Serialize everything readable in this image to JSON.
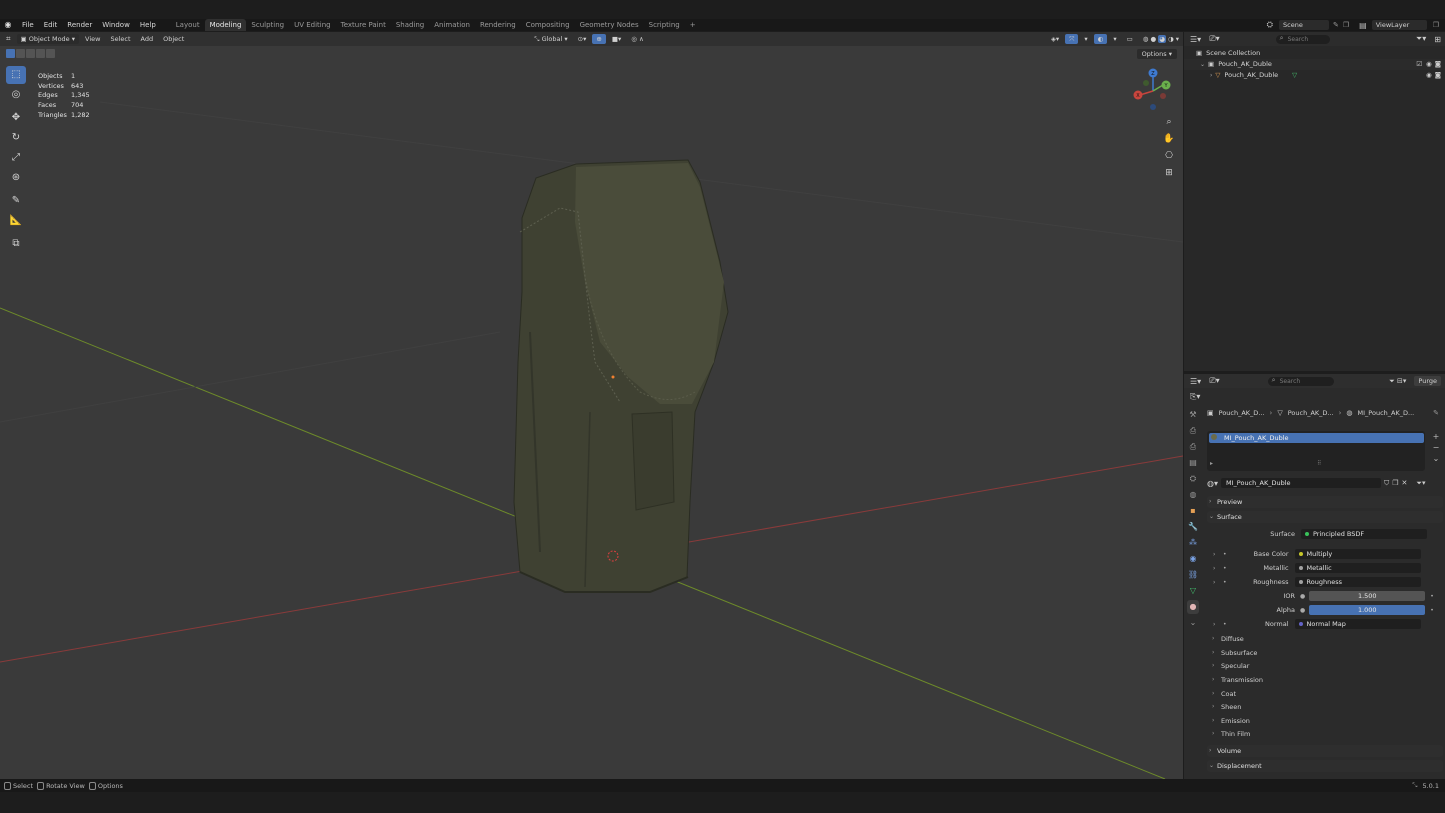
{
  "menu": [
    "File",
    "Edit",
    "Render",
    "Window",
    "Help"
  ],
  "workspaces": [
    {
      "label": "Layout",
      "active": false
    },
    {
      "label": "Modeling",
      "active": true
    },
    {
      "label": "Sculpting",
      "active": false
    },
    {
      "label": "UV Editing",
      "active": false
    },
    {
      "label": "Texture Paint",
      "active": false
    },
    {
      "label": "Shading",
      "active": false
    },
    {
      "label": "Animation",
      "active": false
    },
    {
      "label": "Rendering",
      "active": false
    },
    {
      "label": "Compositing",
      "active": false
    },
    {
      "label": "Geometry Nodes",
      "active": false
    },
    {
      "label": "Scripting",
      "active": false
    }
  ],
  "add_workspace": "+",
  "scene": {
    "label": "Scene",
    "view_layer": "ViewLayer"
  },
  "viewport": {
    "mode": "Object Mode",
    "menus": [
      "View",
      "Select",
      "Add",
      "Object"
    ],
    "orientation": "Global",
    "options_label": "Options",
    "stats": [
      {
        "label": "Objects",
        "value": "1"
      },
      {
        "label": "Vertices",
        "value": "643"
      },
      {
        "label": "Edges",
        "value": "1,345"
      },
      {
        "label": "Faces",
        "value": "704"
      },
      {
        "label": "Triangles",
        "value": "1,282"
      }
    ],
    "gizmo": {
      "z": "Z",
      "y": "Y",
      "x": "X"
    }
  },
  "outliner": {
    "search_placeholder": "Search",
    "items": [
      {
        "label": "Scene Collection"
      },
      {
        "label": "Pouch_AK_Duble"
      },
      {
        "label": "Pouch_AK_Duble"
      }
    ]
  },
  "properties": {
    "search_placeholder": "Search",
    "purge_label": "Purge",
    "breadcrumb": [
      "Pouch_AK_D...",
      "Pouch_AK_D...",
      "MI_Pouch_AK_D..."
    ],
    "material_slot": "MI_Pouch_AK_Duble",
    "material_name": "MI_Pouch_AK_Duble",
    "panels": {
      "preview": "Preview",
      "surface": "Surface",
      "volume": "Volume",
      "displacement": "Displacement"
    },
    "surface_rows": [
      {
        "label": "Surface",
        "value": "Principled BSDF",
        "dot": "#39c25a",
        "kind": "link"
      },
      {
        "label": "Base Color",
        "value": "Multiply",
        "dot": "#c7c729",
        "kind": "link"
      },
      {
        "label": "Metallic",
        "value": "Metallic",
        "dot": "#a1a1a1",
        "kind": "link"
      },
      {
        "label": "Roughness",
        "value": "Roughness",
        "dot": "#a1a1a1",
        "kind": "link"
      },
      {
        "label": "IOR",
        "value": "1.500",
        "kind": "num"
      },
      {
        "label": "Alpha",
        "value": "1.000",
        "kind": "num-blue"
      },
      {
        "label": "Normal",
        "value": "Normal Map",
        "dot": "#6363c7",
        "kind": "link"
      }
    ],
    "subpanels": [
      "Diffuse",
      "Subsurface",
      "Specular",
      "Transmission",
      "Coat",
      "Sheen",
      "Emission",
      "Thin Film"
    ]
  },
  "statusbar": {
    "items": [
      "Select",
      "Rotate View",
      "Options"
    ],
    "version": "5.0.1"
  }
}
